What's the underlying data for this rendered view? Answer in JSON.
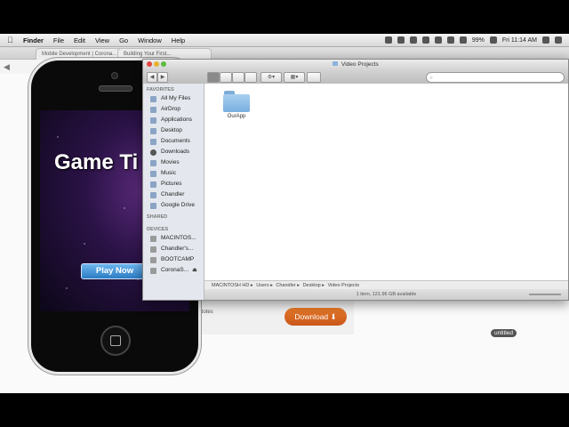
{
  "menubar": {
    "app_name": "Finder",
    "items": [
      "File",
      "Edit",
      "View",
      "Go",
      "Window",
      "Help"
    ],
    "battery": "99%",
    "clock": "Fri 11:14 AM"
  },
  "browser": {
    "tabs": [
      "Mobile Development | Corona...",
      "Building Your First..."
    ],
    "notes_label": "Notes",
    "download_label": "Download"
  },
  "game": {
    "title": "Game Ti",
    "play_label": "Play Now"
  },
  "finder": {
    "title": "Video Projects",
    "sidebar": {
      "favorites_label": "FAVORITES",
      "favorites": [
        "All My Files",
        "AirDrop",
        "Applications",
        "Desktop",
        "Documents",
        "Downloads",
        "Movies",
        "Music",
        "Pictures",
        "Chandler",
        "Google Drive"
      ],
      "shared_label": "SHARED",
      "devices_label": "DEVICES",
      "devices": [
        "MACINTOS...",
        "Chandler's...",
        "BOOTCAMP",
        "CoronaS..."
      ]
    },
    "items": [
      {
        "name": "OurApp"
      }
    ],
    "path": [
      "MACINTOSH HD",
      "Users",
      "Chandler",
      "Desktop",
      "Video Projects"
    ],
    "status": "1 item, 121.96 GB available"
  },
  "dock": {
    "tooltip": "untitled"
  }
}
